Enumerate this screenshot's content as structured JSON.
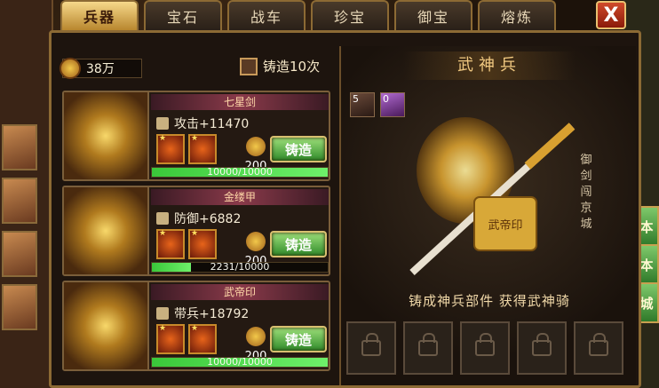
{
  "tabs": [
    {
      "label": "兵器",
      "active": true
    },
    {
      "label": "宝石"
    },
    {
      "label": "战车"
    },
    {
      "label": "珍宝"
    },
    {
      "label": "御宝"
    },
    {
      "label": "熔炼"
    }
  ],
  "close_label": "X",
  "currency": {
    "amount": "38万"
  },
  "forge_ten": {
    "label": "铸造10次"
  },
  "items": [
    {
      "name": "七星剑",
      "stat": "攻击+11470",
      "cost": "200",
      "button": "铸造",
      "progress_text": "10000/10000",
      "progress": 1.0
    },
    {
      "name": "金缕甲",
      "stat": "防御+6882",
      "cost": "200",
      "button": "铸造",
      "progress_text": "2231/10000",
      "progress": 0.2231
    },
    {
      "name": "武帝印",
      "stat": "带兵+18792",
      "cost": "200",
      "button": "铸造",
      "progress_text": "10000/10000",
      "progress": 1.0
    }
  ],
  "showcase": {
    "title": "武神兵",
    "icon1_count": "5",
    "icon2_count": "0",
    "side_text": "御剑闯京城",
    "seal_text": "武帝印",
    "subtitle": "铸成神兵部件 获得武神骑"
  },
  "side_buttons": [
    "本",
    "本",
    "城"
  ]
}
